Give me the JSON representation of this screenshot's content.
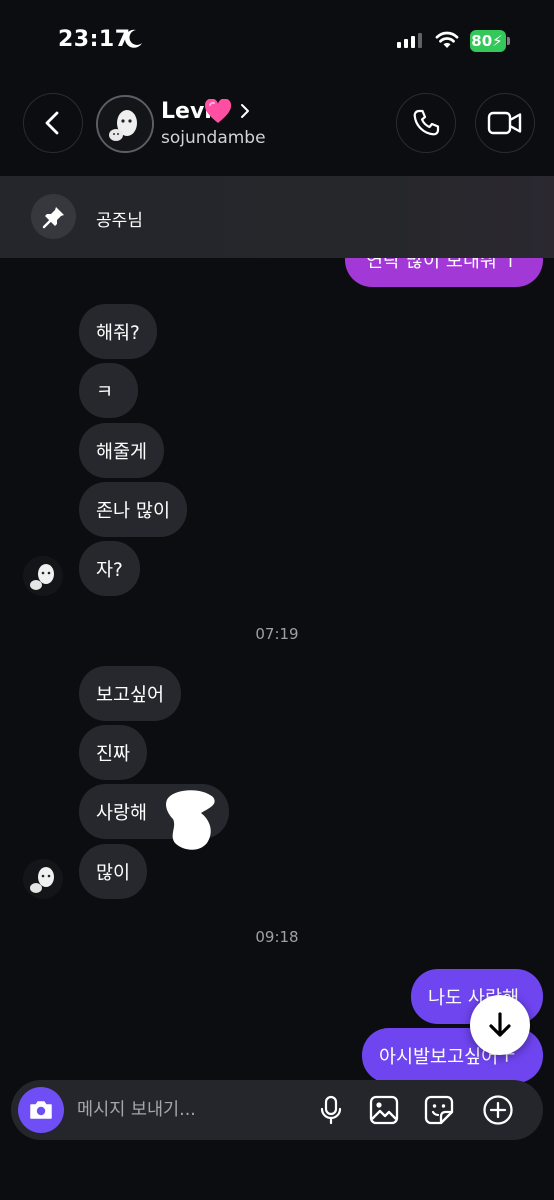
{
  "status_bar": {
    "time": "23:17",
    "battery": "80",
    "icons": [
      "moon-icon",
      "signal-icon",
      "wifi-icon",
      "battery-icon"
    ]
  },
  "header": {
    "contact_name": "Levi",
    "name_emoji": "pink-heart",
    "handle": "sojundambe",
    "icons": [
      "back-icon",
      "chevron-right-icon",
      "phone-icon",
      "video-icon"
    ]
  },
  "pinned": {
    "text": "공주님",
    "icon": "pin-icon"
  },
  "messages": {
    "partial_top": "연락 많이 보내줘 ↑",
    "group1": [
      "해줘?",
      "ㅋ",
      "해줄게",
      "존나 많이",
      "자?"
    ],
    "time1": "07:19",
    "group2": [
      "보고싶어",
      "진짜",
      "사랑해",
      "많이"
    ],
    "time2": "09:18",
    "sent": [
      "나도 사랑해",
      "아시발보고싶어ㅜ"
    ]
  },
  "composer": {
    "placeholder": "메시지 보내기...",
    "icons": [
      "camera-icon",
      "microphone-icon",
      "gallery-icon",
      "sticker-icon",
      "add-icon"
    ]
  },
  "colors": {
    "background": "#0c0d10",
    "received_bubble": "#27282d",
    "sent_bubble": "#6f45f0",
    "sent_bubble_top": "#a238d6",
    "accent": "#6f4ef6",
    "battery": "#34c759"
  }
}
